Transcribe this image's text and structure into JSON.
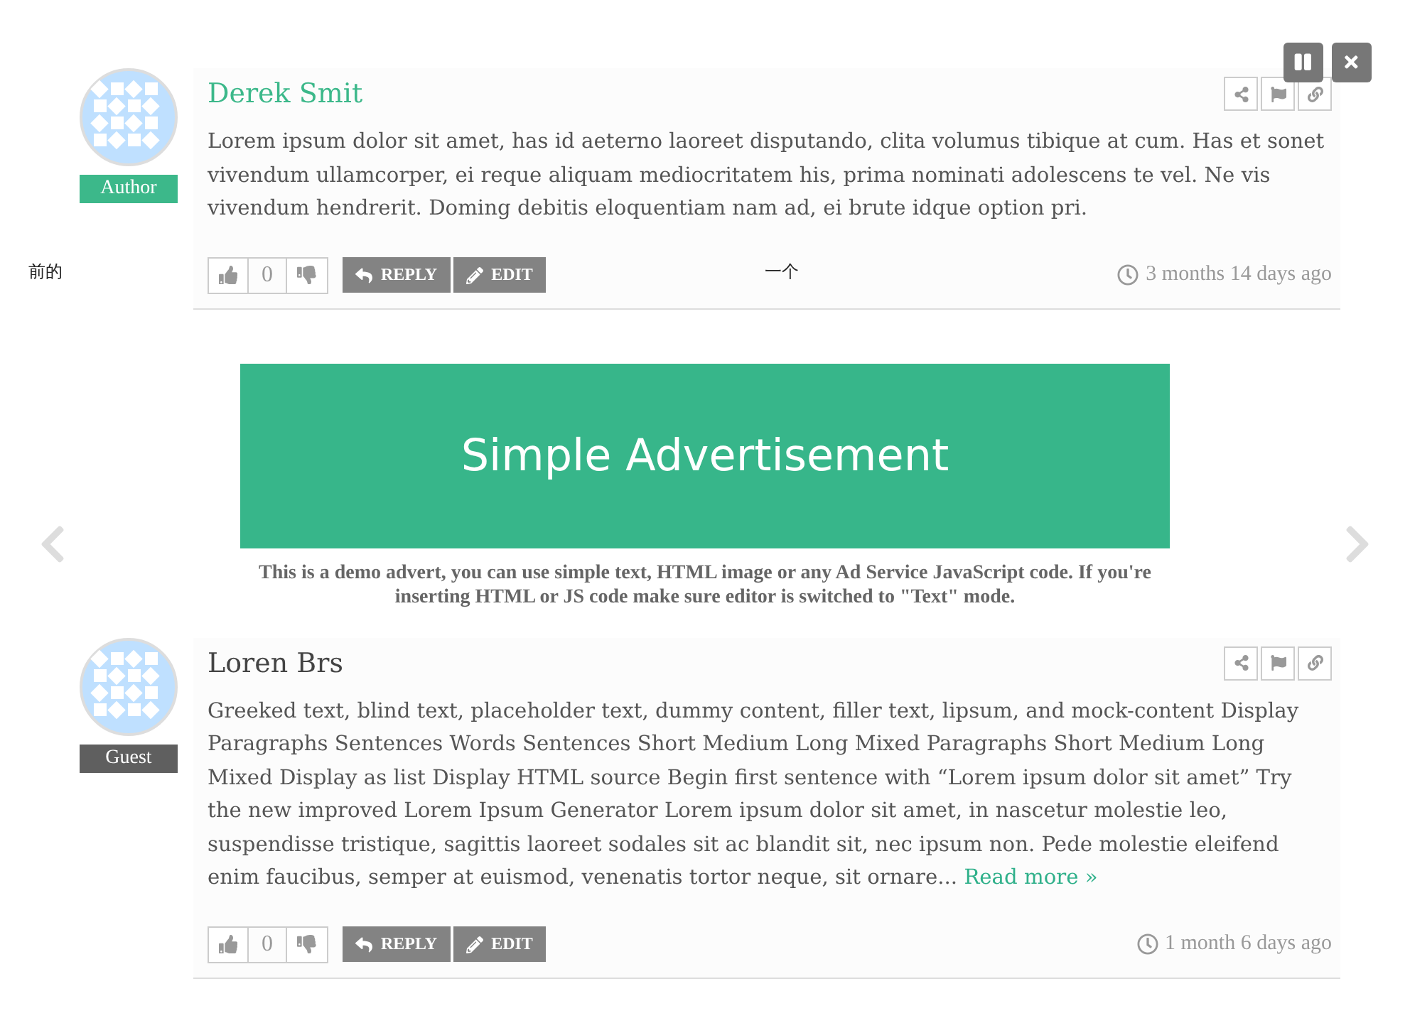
{
  "stray_texts": [
    "前的",
    "一个"
  ],
  "comments": [
    {
      "kind": "author",
      "name": "Derek Smit",
      "badge": "Author",
      "color": "#3cb88a",
      "text": "Lorem ipsum dolor sit amet, has id aeterno laoreet disputando, clita volumus tibique at cum. Has et sonet vivendum ullamcorper, ei reque aliquam mediocritatem his, prima nominati adolescens te vel. Ne vis vivendum hendrerit. Doming debitis eloquentiam nam ad, ei brute idque option pri.",
      "vote_count": "0",
      "reply": "REPLY",
      "edit": "EDIT",
      "time": "3 months 14 days ago"
    },
    {
      "kind": "guest",
      "name": "Loren Brs",
      "badge": "Guest",
      "color": "#5f5f5f",
      "text": "Greeked text, blind text, placeholder text, dummy content, filler text, lipsum, and mock-content Display Paragraphs Sentences Words Sentences Short Medium Long Mixed Paragraphs Short Medium Long Mixed Display as list Display HTML source Begin first sentence with “Lorem ipsum dolor sit amet” Try the new improved Lorem Ipsum Generator Lorem ipsum dolor sit amet, in nascetur molestie leo, suspendisse tristique, sagittis laoreet sodales sit ac blandit sit, nec ipsum non. Pede molestie eleifend enim faucibus, semper at euismod, venenatis tortor neque, sit ornare...",
      "read_more": "Read more »",
      "vote_count": "0",
      "reply": "REPLY",
      "edit": "EDIT",
      "time": "1 month 6 days ago"
    }
  ],
  "ad": {
    "title": "Simple Advertisement",
    "caption": "This is a demo advert, you can use simple text, HTML image or any Ad Service JavaScript code. If you're inserting HTML or JS code make sure editor is switched to \"Text\" mode."
  }
}
